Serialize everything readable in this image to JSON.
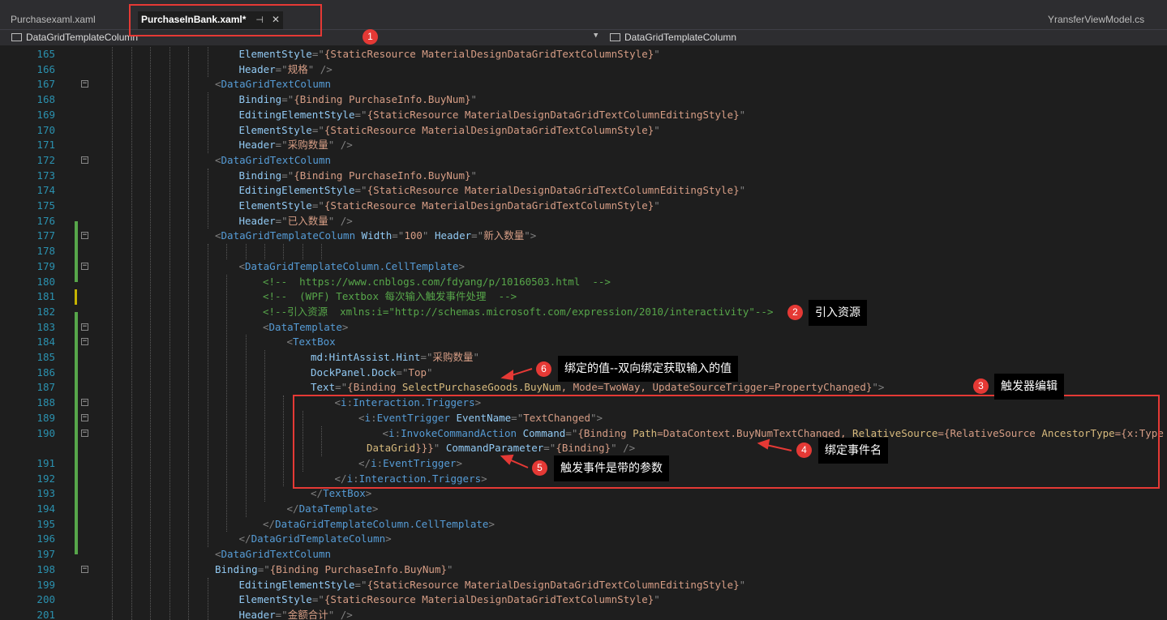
{
  "tabs": [
    {
      "label": "Purchasexaml.xaml",
      "active": false
    },
    {
      "label": "PurchaseInBank.xaml*",
      "active": true
    },
    {
      "label": "YransferViewModel.cs",
      "active": false
    }
  ],
  "nav": {
    "left": "DataGridTemplateColumn",
    "right": "DataGridTemplateColumn"
  },
  "lines": [
    {
      "n": "165",
      "html": "<span class=\"at\">ElementStyle</span><span class=\"br\">=\"</span><span class=\"st\">{StaticResource MaterialDesignDataGridTextColumnStyle}</span><span class=\"br\">\"</span>"
    },
    {
      "n": "166",
      "html": "<span class=\"at\">Header</span><span class=\"br\">=\"</span><span class=\"st\">规格</span><span class=\"br\">\" /&gt;</span>"
    },
    {
      "n": "167",
      "html": "<span class=\"br\">&lt;</span><span class=\"t\">DataGridTextColumn</span>"
    },
    {
      "n": "168",
      "html": "<span class=\"at\">Binding</span><span class=\"br\">=\"</span><span class=\"st\">{Binding PurchaseInfo.BuyNum}</span><span class=\"br\">\"</span>"
    },
    {
      "n": "169",
      "html": "<span class=\"at\">EditingElementStyle</span><span class=\"br\">=\"</span><span class=\"st\">{StaticResource MaterialDesignDataGridTextColumnEditingStyle}</span><span class=\"br\">\"</span>"
    },
    {
      "n": "170",
      "html": "<span class=\"at\">ElementStyle</span><span class=\"br\">=\"</span><span class=\"st\">{StaticResource MaterialDesignDataGridTextColumnStyle}</span><span class=\"br\">\"</span>"
    },
    {
      "n": "171",
      "html": "<span class=\"at\">Header</span><span class=\"br\">=\"</span><span class=\"st\">采购数量</span><span class=\"br\">\" /&gt;</span>"
    },
    {
      "n": "172",
      "html": "<span class=\"br\">&lt;</span><span class=\"t\">DataGridTextColumn</span>"
    },
    {
      "n": "173",
      "html": "<span class=\"at\">Binding</span><span class=\"br\">=\"</span><span class=\"st\">{Binding PurchaseInfo.BuyNum}</span><span class=\"br\">\"</span>"
    },
    {
      "n": "174",
      "html": "<span class=\"at\">EditingElementStyle</span><span class=\"br\">=\"</span><span class=\"st\">{StaticResource MaterialDesignDataGridTextColumnEditingStyle}</span><span class=\"br\">\"</span>"
    },
    {
      "n": "175",
      "html": "<span class=\"at\">ElementStyle</span><span class=\"br\">=\"</span><span class=\"st\">{StaticResource MaterialDesignDataGridTextColumnStyle}</span><span class=\"br\">\"</span>"
    },
    {
      "n": "176",
      "html": "<span class=\"at\">Header</span><span class=\"br\">=\"</span><span class=\"st\">已入数量</span><span class=\"br\">\" /&gt;</span>"
    },
    {
      "n": "177",
      "html": "<span class=\"br\">&lt;</span><span class=\"t\">DataGridTemplateColumn</span> <span class=\"at\">Width</span><span class=\"br\">=\"</span><span class=\"st\">100</span><span class=\"br\">\"</span> <span class=\"at\">Header</span><span class=\"br\">=\"</span><span class=\"st\">新入数量</span><span class=\"br\">\"&gt;</span>"
    },
    {
      "n": "178",
      "html": ""
    },
    {
      "n": "179",
      "html": "<span class=\"br\">&lt;</span><span class=\"t\">DataGridTemplateColumn.CellTemplate</span><span class=\"br\">&gt;</span>"
    },
    {
      "n": "180",
      "html": "<span class=\"cm\">&lt;!--  https://www.cnblogs.com/fdyang/p/10160503.html  --&gt;</span>"
    },
    {
      "n": "181",
      "html": "<span class=\"cm\">&lt;!--  (WPF) Textbox 每次输入触发事件处理  --&gt;</span>"
    },
    {
      "n": "182",
      "html": "<span class=\"cm\">&lt;!--引入资源  xmlns:i=\"http://schemas.microsoft.com/expression/2010/interactivity\"--&gt;</span>"
    },
    {
      "n": "183",
      "html": "<span class=\"br\">&lt;</span><span class=\"t\">DataTemplate</span><span class=\"br\">&gt;</span>"
    },
    {
      "n": "184",
      "html": "<span class=\"br\">&lt;</span><span class=\"t\">TextBox</span>"
    },
    {
      "n": "185",
      "html": "<span class=\"at\">md:HintAssist.Hint</span><span class=\"br\">=\"</span><span class=\"st\">采购数量</span><span class=\"br\">\"</span>"
    },
    {
      "n": "186",
      "html": "<span class=\"at\">DockPanel.Dock</span><span class=\"br\">=\"</span><span class=\"st\">Top</span><span class=\"br\">\"</span>"
    },
    {
      "n": "187",
      "html": "<span class=\"at\">Text</span><span class=\"br\">=\"</span><span class=\"st\">{Binding <span class=\"mk\">SelectPurchaseGoods.BuyNum</span>, Mode=TwoWay, UpdateSourceTrigger=PropertyChanged}</span><span class=\"br\">\"&gt;</span>"
    },
    {
      "n": "188",
      "html": "<span class=\"br\">&lt;</span><span class=\"t\">i</span><span class=\"br\">:</span><span class=\"t\">Interaction.Triggers</span><span class=\"br\">&gt;</span>"
    },
    {
      "n": "189",
      "html": "<span class=\"br\">&lt;</span><span class=\"t\">i</span><span class=\"br\">:</span><span class=\"t\">EventTrigger</span> <span class=\"at\">EventName</span><span class=\"br\">=\"</span><span class=\"st\">TextChanged</span><span class=\"br\">\"&gt;</span>"
    },
    {
      "n": "190",
      "html": "<span class=\"br\">&lt;</span><span class=\"t\">i</span><span class=\"br\">:</span><span class=\"t\">InvokeCommandAction</span> <span class=\"at\">Command</span><span class=\"br\">=\"</span><span class=\"st\">{Binding <span class=\"mk\">Path</span>=DataContext.BuyNumTextChanged, <span class=\"mk\">RelativeSource</span>={RelativeSource <span class=\"mk\">AncestorType</span>={x:Type</span>"
    },
    {
      "n": "",
      "html": "<span class=\"st\"><span class=\"mk\">DataGrid</span>}}}</span><span class=\"br\">\"</span> <span class=\"at\">CommandParameter</span><span class=\"br\">=\"</span><span class=\"st\">{Binding}</span><span class=\"br\">\" /&gt;</span>"
    },
    {
      "n": "191",
      "html": "<span class=\"br\">&lt;/</span><span class=\"t\">i</span><span class=\"br\">:</span><span class=\"t\">EventTrigger</span><span class=\"br\">&gt;</span>"
    },
    {
      "n": "192",
      "html": "<span class=\"br\">&lt;/</span><span class=\"t\">i</span><span class=\"br\">:</span><span class=\"t\">Interaction.Triggers</span><span class=\"br\">&gt;</span>"
    },
    {
      "n": "193",
      "html": "<span class=\"br\">&lt;/</span><span class=\"t\">TextBox</span><span class=\"br\">&gt;</span>"
    },
    {
      "n": "194",
      "html": "<span class=\"br\">&lt;/</span><span class=\"t\">DataTemplate</span><span class=\"br\">&gt;</span>"
    },
    {
      "n": "195",
      "html": "<span class=\"br\">&lt;/</span><span class=\"t\">DataGridTemplateColumn.CellTemplate</span><span class=\"br\">&gt;</span>"
    },
    {
      "n": "196",
      "html": "<span class=\"br\">&lt;/</span><span class=\"t\">DataGridTemplateColumn</span><span class=\"br\">&gt;</span>"
    },
    {
      "n": "197",
      "html": "<span class=\"br\">&lt;</span><span class=\"t\">DataGridTextColumn</span>"
    },
    {
      "n": "198",
      "html": "<span class=\"at\">Binding</span><span class=\"br\">=\"</span><span class=\"st\">{Binding PurchaseInfo.BuyNum}</span><span class=\"br\">\"</span>"
    },
    {
      "n": "199",
      "html": "<span class=\"at\">EditingElementStyle</span><span class=\"br\">=\"</span><span class=\"st\">{StaticResource MaterialDesignDataGridTextColumnEditingStyle}</span><span class=\"br\">\"</span>"
    },
    {
      "n": "200",
      "html": "<span class=\"at\">ElementStyle</span><span class=\"br\">=\"</span><span class=\"st\">{StaticResource MaterialDesignDataGridTextColumnStyle}</span><span class=\"br\">\"</span>"
    },
    {
      "n": "201",
      "html": "<span class=\"at\">Header</span><span class=\"br\">=\"</span><span class=\"st\">金额合计</span><span class=\"br\">\" /&gt;</span>"
    }
  ],
  "annotations": [
    {
      "num": "1",
      "text": ""
    },
    {
      "num": "2",
      "text": "引入资源"
    },
    {
      "num": "3",
      "text": "触发器编辑"
    },
    {
      "num": "4",
      "text": "绑定事件名"
    },
    {
      "num": "5",
      "text": "触发事件是带的参数"
    },
    {
      "num": "6",
      "text": "绑定的值--双向绑定获取输入的值"
    }
  ],
  "colors": {
    "background": "#1e1e1e",
    "element": "#569cd6",
    "attribute": "#92caf4",
    "string": "#d69d85",
    "comment": "#57a64a",
    "line_number": "#2b91af",
    "highlight": "#e53935"
  }
}
